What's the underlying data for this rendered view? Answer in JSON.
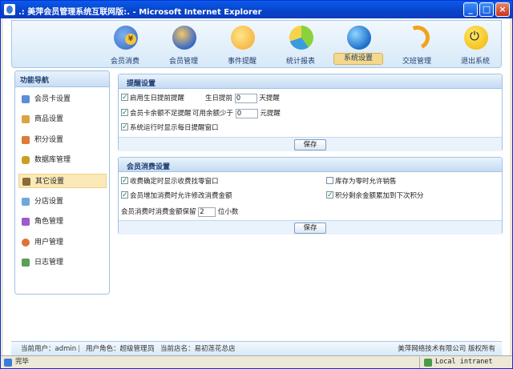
{
  "window": {
    "title": ".: 美萍会员管理系统互联网版:. - Microsoft Internet Explorer",
    "minimize": "_",
    "maximize": "□",
    "close": "×"
  },
  "nav": [
    {
      "label": "会员消费",
      "icon": "yen-coin-icon"
    },
    {
      "label": "会员管理",
      "icon": "users-icon"
    },
    {
      "label": "事件提醒",
      "icon": "chat-bubble-icon"
    },
    {
      "label": "统计报表",
      "icon": "pie-chart-icon"
    },
    {
      "label": "系统设置",
      "icon": "globe-settings-icon",
      "active": true
    },
    {
      "label": "交班管理",
      "icon": "refresh-arrow-icon"
    },
    {
      "label": "退出系统",
      "icon": "power-icon"
    }
  ],
  "sidebar": {
    "title": "功能导航",
    "items": [
      {
        "label": "会员卡设置",
        "icon": "card-icon"
      },
      {
        "label": "商品设置",
        "icon": "box-icon"
      },
      {
        "label": "积分设置",
        "icon": "points-icon"
      },
      {
        "label": "数据库管理",
        "icon": "database-icon"
      },
      {
        "label": "其它设置",
        "icon": "wrench-icon",
        "active": true
      },
      {
        "label": "分店设置",
        "icon": "store-icon"
      },
      {
        "label": "角色管理",
        "icon": "role-icon"
      },
      {
        "label": "用户管理",
        "icon": "user-icon"
      },
      {
        "label": "日志管理",
        "icon": "log-icon"
      }
    ]
  },
  "reminder": {
    "title": "提醒设置",
    "birthday_label": "启用生日提前提醒",
    "birthday_before": "生日提前",
    "birthday_days": "0",
    "birthday_suffix": "天提醒",
    "balance_label": "会员卡余额不足提醒",
    "balance_before": "可用余额少于",
    "balance_value": "0",
    "balance_suffix": "元提醒",
    "daily_label": "系统运行时显示每日提醒窗口",
    "save": "保存"
  },
  "consume": {
    "title": "会员消费设置",
    "change_label": "收费确定时显示收费找零窗口",
    "stock_label": "库存为零时允许销售",
    "modify_label": "会员增加消费时允许修改消费金额",
    "points_label": "积分剩余金额累加到下次积分",
    "decimal_before": "会员消费时消费金额保留",
    "decimal_value": "2",
    "decimal_suffix": "位小数",
    "save": "保存"
  },
  "footer": {
    "user": "当前用户：admin",
    "role": "用户角色：超级管理员",
    "store": "当前店名：易初莲花总店",
    "copyright": "美萍网络技术有限公司 版权所有"
  },
  "status": {
    "done": "完毕",
    "zone": "Local intranet"
  }
}
